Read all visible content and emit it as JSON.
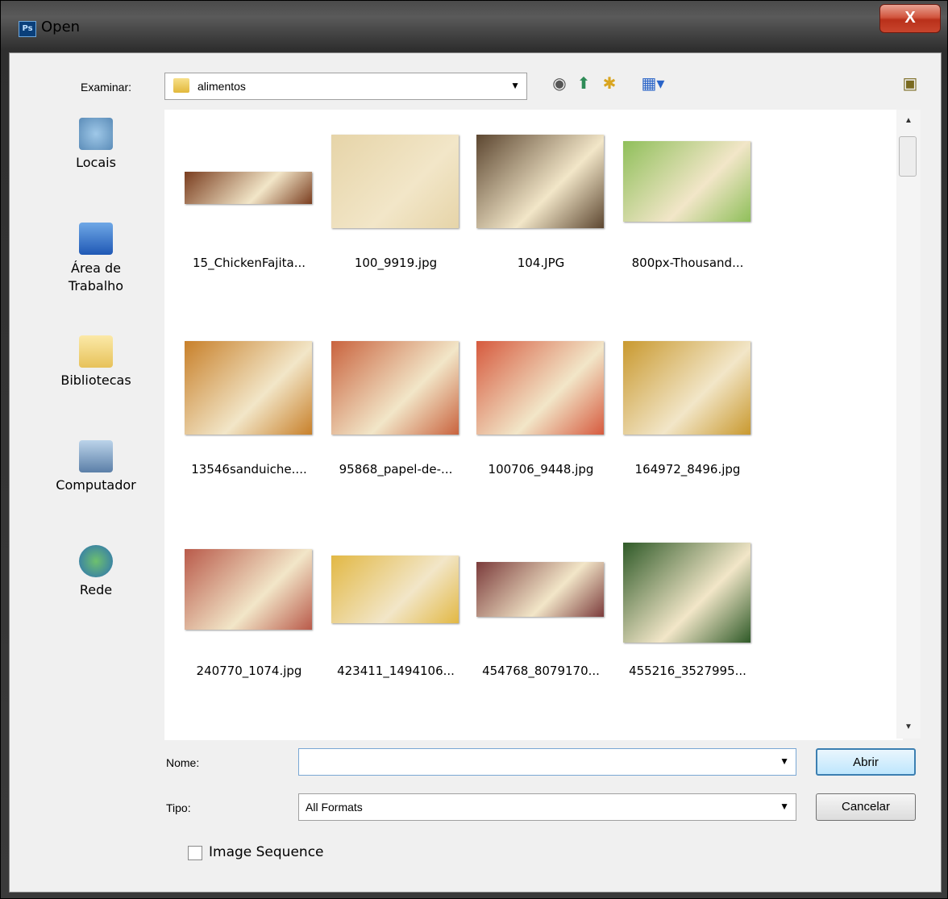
{
  "window": {
    "title": "Open",
    "app_badge": "Ps",
    "close_glyph": "X"
  },
  "toolbar": {
    "look_in_label": "Examinar:",
    "look_in_value": "alimentos",
    "icons": [
      "back-icon",
      "up-folder-icon",
      "new-folder-icon",
      "view-menu-icon",
      "folder-star-icon"
    ]
  },
  "places": [
    {
      "label": "Locais",
      "icon": "recent-places-icon"
    },
    {
      "label": "Área de Trabalho",
      "icon": "desktop-icon"
    },
    {
      "label": "Bibliotecas",
      "icon": "libraries-icon"
    },
    {
      "label": "Computador",
      "icon": "computer-icon"
    },
    {
      "label": "Rede",
      "icon": "network-icon"
    }
  ],
  "files": [
    {
      "name": "15_ChickenFajita...",
      "color": "#7a3d1f"
    },
    {
      "name": "100_9919.jpg",
      "color": "#e6d4a8"
    },
    {
      "name": "104.JPG",
      "color": "#5c4630"
    },
    {
      "name": "800px-Thousand...",
      "color": "#8fbf5a"
    },
    {
      "name": "13546sanduiche....",
      "color": "#c8802a"
    },
    {
      "name": "95868_papel-de-...",
      "color": "#c9633e"
    },
    {
      "name": "100706_9448.jpg",
      "color": "#d65a3e"
    },
    {
      "name": "164972_8496.jpg",
      "color": "#c9992f"
    },
    {
      "name": "240770_1074.jpg",
      "color": "#b95a4a"
    },
    {
      "name": "423411_1494106...",
      "color": "#e2b844"
    },
    {
      "name": "454768_8079170...",
      "color": "#7b3b3b"
    },
    {
      "name": "455216_3527995...",
      "color": "#2f5a28"
    }
  ],
  "form": {
    "name_label": "Nome:",
    "name_value": "",
    "type_label": "Tipo:",
    "type_value": "All Formats",
    "open_button": "Abrir",
    "cancel_button": "Cancelar",
    "image_sequence_label": "Image Sequence",
    "image_sequence_checked": false
  }
}
